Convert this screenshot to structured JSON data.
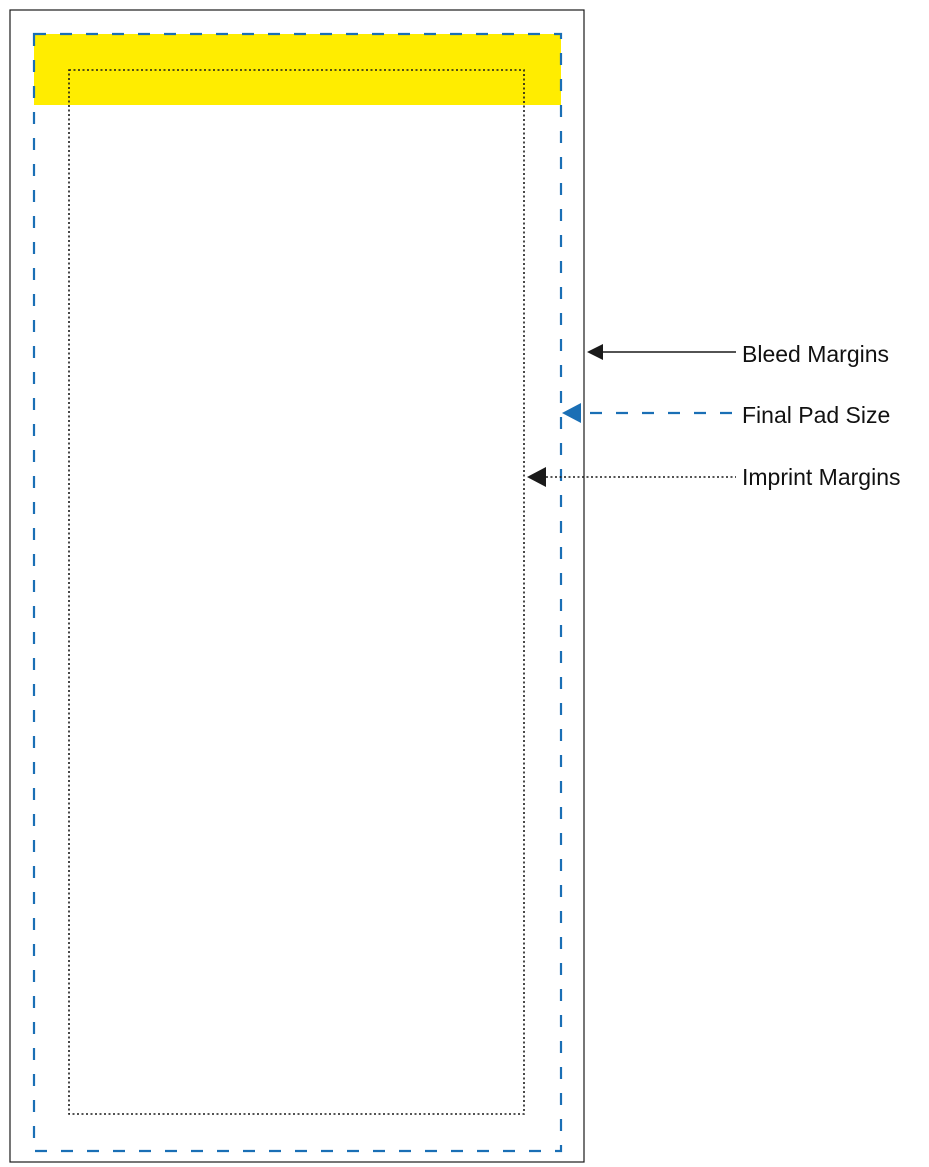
{
  "labels": {
    "bleed_margins": "Bleed Margins",
    "final_pad_size": "Final Pad Size",
    "imprint_margins": "Imprint Margins"
  },
  "colors": {
    "bleed_line": "#1a1a1a",
    "final_pad_line": "#1a6fb5",
    "imprint_line": "#1a1a1a",
    "header_band": "#ffed00",
    "label_text": "#111111"
  }
}
